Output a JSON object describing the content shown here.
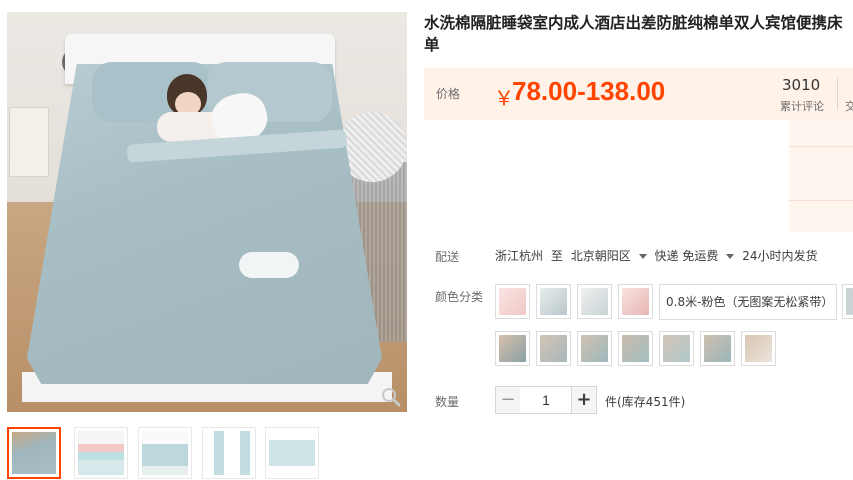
{
  "product": {
    "title": "水洗棉隔脏睡袋室内成人酒店出差防脏纯棉单双人宾馆便携床单"
  },
  "price": {
    "label": "价格",
    "currency": "￥",
    "value": "78.00-138.00",
    "reviews_count": "3010",
    "reviews_label": "累计评论",
    "next_stat_label_partial": "交",
    "color": "#ff4400"
  },
  "shipping": {
    "label": "配送",
    "from": "浙江杭州",
    "to_prefix": "至",
    "destination": "北京朝阳区",
    "method": "快递 免运费",
    "dispatch": "24小时内发货"
  },
  "color_options": {
    "label": "颜色分类",
    "selected_text": "0.8米-粉色（无图案无松紧带）"
  },
  "quantity": {
    "label": "数量",
    "minus": "−",
    "value": "1",
    "plus": "+",
    "stock": "件(库存451件)"
  },
  "icons": {
    "zoom": "magnifier-icon",
    "caret": "caret-down-icon"
  }
}
